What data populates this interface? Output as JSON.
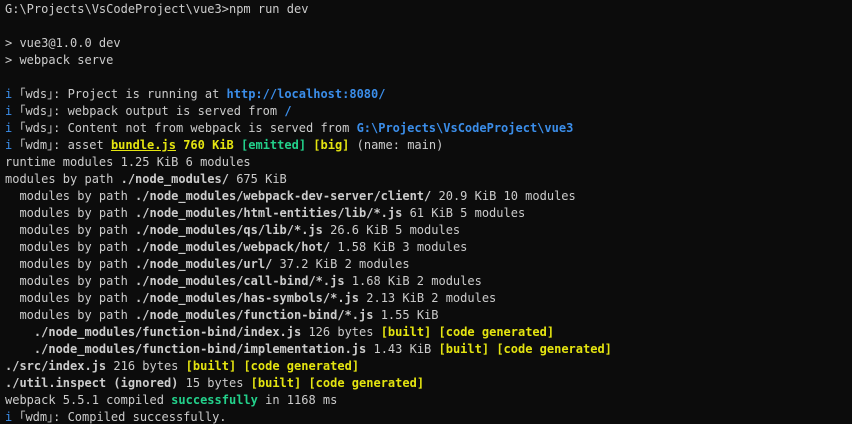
{
  "lines": [
    [
      {
        "t": "G:\\Projects\\VsCodeProject\\vue3>npm run dev"
      }
    ],
    [],
    [
      {
        "t": "> vue3@1.0.0 dev"
      }
    ],
    [
      {
        "t": "> webpack serve"
      }
    ],
    [],
    [
      {
        "t": "i ",
        "c": "blue"
      },
      {
        "t": "｢wds｣: Project is running at "
      },
      {
        "t": "http://localhost:8080/",
        "c": "blue bold"
      }
    ],
    [
      {
        "t": "i ",
        "c": "blue"
      },
      {
        "t": "｢wds｣: webpack output is served from "
      },
      {
        "t": "/",
        "c": "blue bold"
      }
    ],
    [
      {
        "t": "i ",
        "c": "blue"
      },
      {
        "t": "｢wds｣: Content not from webpack is served from "
      },
      {
        "t": "G:\\Projects\\VsCodeProject\\vue3",
        "c": "blue bold"
      }
    ],
    [
      {
        "t": "i ",
        "c": "blue"
      },
      {
        "t": "｢wdm｣: asset "
      },
      {
        "t": "bundle.js",
        "c": "yellow bold ul"
      },
      {
        "t": " "
      },
      {
        "t": "760 KiB",
        "c": "yellow bold"
      },
      {
        "t": " "
      },
      {
        "t": "[emitted]",
        "c": "green bold"
      },
      {
        "t": " "
      },
      {
        "t": "[big]",
        "c": "yellow bold"
      },
      {
        "t": " (name: main)"
      }
    ],
    [
      {
        "t": "runtime modules 1.25 KiB 6 modules"
      }
    ],
    [
      {
        "t": "modules by path "
      },
      {
        "t": "./node_modules/",
        "c": "bold"
      },
      {
        "t": " 675 KiB"
      }
    ],
    [
      {
        "t": "  modules by path "
      },
      {
        "t": "./node_modules/webpack-dev-server/client/",
        "c": "bold"
      },
      {
        "t": " 20.9 KiB 10 modules"
      }
    ],
    [
      {
        "t": "  modules by path "
      },
      {
        "t": "./node_modules/html-entities/lib/*.js",
        "c": "bold"
      },
      {
        "t": " 61 KiB 5 modules"
      }
    ],
    [
      {
        "t": "  modules by path "
      },
      {
        "t": "./node_modules/qs/lib/*.js",
        "c": "bold"
      },
      {
        "t": " 26.6 KiB 5 modules"
      }
    ],
    [
      {
        "t": "  modules by path "
      },
      {
        "t": "./node_modules/webpack/hot/",
        "c": "bold"
      },
      {
        "t": " 1.58 KiB 3 modules"
      }
    ],
    [
      {
        "t": "  modules by path "
      },
      {
        "t": "./node_modules/url/",
        "c": "bold"
      },
      {
        "t": " 37.2 KiB 2 modules"
      }
    ],
    [
      {
        "t": "  modules by path "
      },
      {
        "t": "./node_modules/call-bind/*.js",
        "c": "bold"
      },
      {
        "t": " 1.68 KiB 2 modules"
      }
    ],
    [
      {
        "t": "  modules by path "
      },
      {
        "t": "./node_modules/has-symbols/*.js",
        "c": "bold"
      },
      {
        "t": " 2.13 KiB 2 modules"
      }
    ],
    [
      {
        "t": "  modules by path "
      },
      {
        "t": "./node_modules/function-bind/*.js",
        "c": "bold"
      },
      {
        "t": " 1.55 KiB"
      }
    ],
    [
      {
        "t": "    "
      },
      {
        "t": "./node_modules/function-bind/index.js",
        "c": "bold"
      },
      {
        "t": " 126 bytes "
      },
      {
        "t": "[built]",
        "c": "yellow bold"
      },
      {
        "t": " "
      },
      {
        "t": "[code generated]",
        "c": "yellow bold"
      }
    ],
    [
      {
        "t": "    "
      },
      {
        "t": "./node_modules/function-bind/implementation.js",
        "c": "bold"
      },
      {
        "t": " 1.43 KiB "
      },
      {
        "t": "[built]",
        "c": "yellow bold"
      },
      {
        "t": " "
      },
      {
        "t": "[code generated]",
        "c": "yellow bold"
      }
    ],
    [
      {
        "t": "./src/index.js",
        "c": "bold"
      },
      {
        "t": " 216 bytes "
      },
      {
        "t": "[built]",
        "c": "yellow bold"
      },
      {
        "t": " "
      },
      {
        "t": "[code generated]",
        "c": "yellow bold"
      }
    ],
    [
      {
        "t": "./util.inspect (ignored)",
        "c": "bold"
      },
      {
        "t": " 15 bytes "
      },
      {
        "t": "[built]",
        "c": "yellow bold"
      },
      {
        "t": " "
      },
      {
        "t": "[code generated]",
        "c": "yellow bold"
      }
    ],
    [
      {
        "t": "webpack 5.5.1 compiled "
      },
      {
        "t": "successfully",
        "c": "green bold"
      },
      {
        "t": " in 1168 ms"
      }
    ],
    [
      {
        "t": "i ",
        "c": "blue"
      },
      {
        "t": "｢wdm｣: Compiled successfully."
      }
    ]
  ]
}
